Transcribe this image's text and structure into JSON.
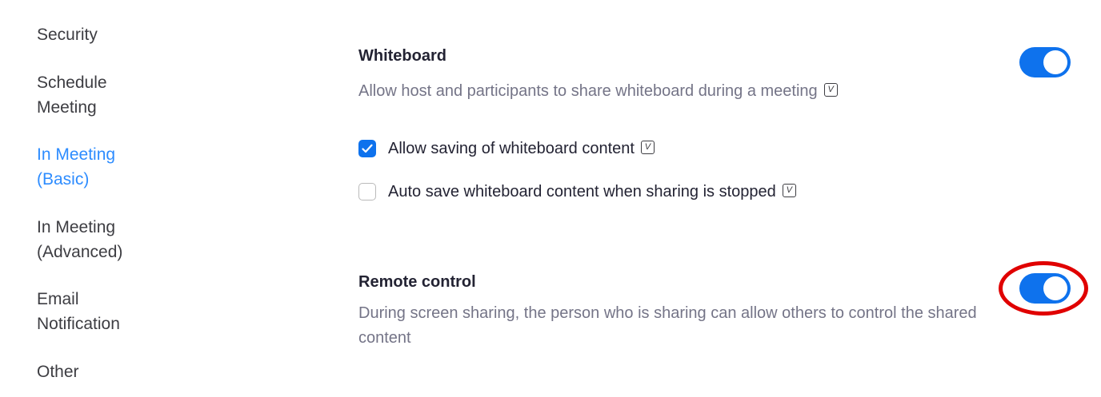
{
  "sidebar": {
    "items": [
      {
        "label": "Security",
        "active": false
      },
      {
        "label": "Schedule\nMeeting",
        "active": false
      },
      {
        "label": "In Meeting\n(Basic)",
        "active": true
      },
      {
        "label": "In Meeting\n(Advanced)",
        "active": false
      },
      {
        "label": "Email\nNotification",
        "active": false
      },
      {
        "label": "Other",
        "active": false
      }
    ]
  },
  "whiteboard": {
    "title": "Whiteboard",
    "description": "Allow host and participants to share whiteboard during a meeting",
    "toggle_on": true,
    "options": [
      {
        "label": "Allow saving of whiteboard content",
        "checked": true
      },
      {
        "label": "Auto save whiteboard content when sharing is stopped",
        "checked": false
      }
    ]
  },
  "remote_control": {
    "title": "Remote control",
    "description": "During screen sharing, the person who is sharing can allow others to control the shared content",
    "toggle_on": true
  },
  "icons": {
    "version_badge": "V"
  },
  "colors": {
    "accent": "#0e72ed",
    "active_nav": "#2d8cff",
    "highlight": "#e00000"
  }
}
